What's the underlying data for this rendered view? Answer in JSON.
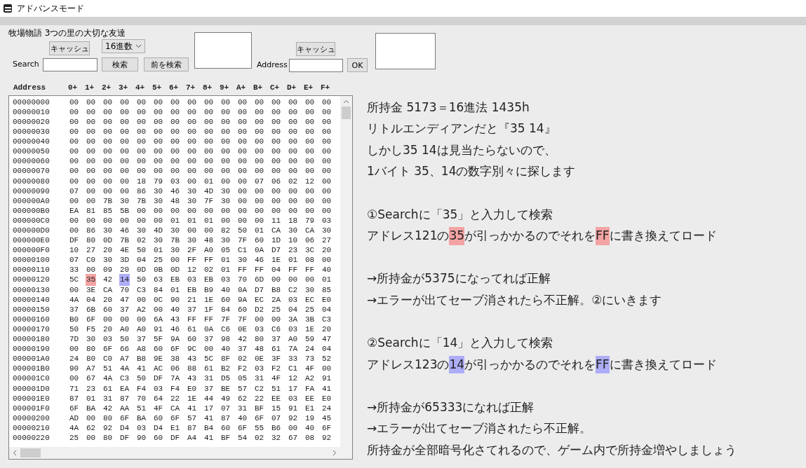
{
  "window": {
    "title": "アドバンスモード"
  },
  "game_title": "牧場物語 3つの里の大切な友達",
  "search_panel": {
    "cache_button": "キャッシュ",
    "radix_select": "16進数",
    "search_label": "Search",
    "search_button": "検索",
    "prev_button": "前を検索"
  },
  "address_panel": {
    "cache_button": "キャッシュ",
    "address_label": "Address",
    "ok_button": "OK"
  },
  "hex_header": {
    "address": "Address",
    "columns": [
      "0+",
      "1+",
      "2+",
      "3+",
      "4+",
      "5+",
      "6+",
      "7+",
      "8+",
      "9+",
      "A+",
      "B+",
      "C+",
      "D+",
      "E+",
      "F+"
    ]
  },
  "hex_rows": [
    {
      "address": "00000000",
      "bytes": [
        "00",
        "00",
        "00",
        "00",
        "00",
        "00",
        "00",
        "00",
        "00",
        "00",
        "00",
        "00",
        "00",
        "00",
        "00",
        "00"
      ]
    },
    {
      "address": "00000010",
      "bytes": [
        "00",
        "00",
        "00",
        "00",
        "00",
        "00",
        "00",
        "00",
        "00",
        "00",
        "00",
        "00",
        "00",
        "00",
        "00",
        "00"
      ]
    },
    {
      "address": "00000020",
      "bytes": [
        "00",
        "00",
        "00",
        "00",
        "00",
        "00",
        "00",
        "00",
        "00",
        "00",
        "00",
        "00",
        "00",
        "00",
        "00",
        "00"
      ]
    },
    {
      "address": "00000030",
      "bytes": [
        "00",
        "00",
        "00",
        "00",
        "00",
        "00",
        "00",
        "00",
        "00",
        "00",
        "00",
        "00",
        "00",
        "00",
        "00",
        "00"
      ]
    },
    {
      "address": "00000040",
      "bytes": [
        "00",
        "00",
        "00",
        "00",
        "00",
        "00",
        "00",
        "00",
        "00",
        "00",
        "00",
        "00",
        "00",
        "00",
        "00",
        "00"
      ]
    },
    {
      "address": "00000050",
      "bytes": [
        "00",
        "00",
        "00",
        "00",
        "00",
        "00",
        "00",
        "00",
        "00",
        "00",
        "00",
        "00",
        "00",
        "00",
        "00",
        "00"
      ]
    },
    {
      "address": "00000060",
      "bytes": [
        "00",
        "00",
        "00",
        "00",
        "00",
        "00",
        "00",
        "00",
        "00",
        "00",
        "00",
        "00",
        "00",
        "00",
        "00",
        "00"
      ]
    },
    {
      "address": "00000070",
      "bytes": [
        "00",
        "00",
        "00",
        "00",
        "00",
        "00",
        "00",
        "00",
        "00",
        "00",
        "00",
        "00",
        "00",
        "00",
        "00",
        "00"
      ]
    },
    {
      "address": "00000080",
      "bytes": [
        "00",
        "00",
        "00",
        "00",
        "18",
        "79",
        "03",
        "00",
        "01",
        "00",
        "00",
        "07",
        "06",
        "02",
        "12",
        "00"
      ]
    },
    {
      "address": "00000090",
      "bytes": [
        "07",
        "00",
        "00",
        "00",
        "86",
        "30",
        "46",
        "30",
        "4D",
        "30",
        "00",
        "00",
        "00",
        "00",
        "00",
        "00"
      ]
    },
    {
      "address": "000000A0",
      "bytes": [
        "00",
        "00",
        "7B",
        "30",
        "7B",
        "30",
        "48",
        "30",
        "7F",
        "30",
        "00",
        "00",
        "00",
        "00",
        "00",
        "00"
      ]
    },
    {
      "address": "000000B0",
      "bytes": [
        "EA",
        "81",
        "85",
        "5B",
        "00",
        "00",
        "00",
        "00",
        "00",
        "00",
        "00",
        "00",
        "00",
        "00",
        "00",
        "00"
      ]
    },
    {
      "address": "000000C0",
      "bytes": [
        "00",
        "00",
        "00",
        "00",
        "00",
        "00",
        "01",
        "01",
        "01",
        "00",
        "00",
        "00",
        "11",
        "18",
        "79",
        "03"
      ]
    },
    {
      "address": "000000D0",
      "bytes": [
        "00",
        "86",
        "30",
        "46",
        "30",
        "4D",
        "30",
        "00",
        "00",
        "82",
        "50",
        "01",
        "CA",
        "30",
        "CA",
        "30"
      ]
    },
    {
      "address": "000000E0",
      "bytes": [
        "DF",
        "80",
        "0D",
        "7B",
        "02",
        "30",
        "7B",
        "30",
        "48",
        "30",
        "7F",
        "60",
        "1D",
        "10",
        "06",
        "27"
      ]
    },
    {
      "address": "000000F0",
      "bytes": [
        "10",
        "27",
        "20",
        "4E",
        "50",
        "01",
        "30",
        "2F",
        "A0",
        "05",
        "C1",
        "0A",
        "D7",
        "23",
        "3C",
        "20"
      ]
    },
    {
      "address": "00000100",
      "bytes": [
        "07",
        "C0",
        "30",
        "3D",
        "04",
        "25",
        "00",
        "FF",
        "FF",
        "01",
        "30",
        "46",
        "1E",
        "01",
        "08",
        "00"
      ]
    },
    {
      "address": "00000110",
      "bytes": [
        "33",
        "00",
        "09",
        "20",
        "0D",
        "0B",
        "0D",
        "12",
        "02",
        "01",
        "FF",
        "FF",
        "04",
        "FF",
        "FF",
        "40"
      ]
    },
    {
      "address": "00000120",
      "bytes": [
        "5C",
        {
          "text": "35",
          "color": "#f4a3a3"
        },
        "42",
        {
          "text": "14",
          "color": "#adadf7"
        },
        "50",
        "63",
        "EB",
        "03",
        "EB",
        "03",
        "70",
        "6D",
        "00",
        "00",
        "00",
        "01"
      ]
    },
    {
      "address": "00000130",
      "bytes": [
        "00",
        "3E",
        "CA",
        "70",
        "C3",
        "84",
        "01",
        "EB",
        "B9",
        "40",
        "0A",
        "D7",
        "B8",
        "C2",
        "30",
        "85"
      ]
    },
    {
      "address": "00000140",
      "bytes": [
        "4A",
        "04",
        "20",
        "47",
        "00",
        "0C",
        "90",
        "21",
        "1E",
        "60",
        "9A",
        "EC",
        "2A",
        "03",
        "EC",
        "E0"
      ]
    },
    {
      "address": "00000150",
      "bytes": [
        "37",
        "6B",
        "60",
        "37",
        "A2",
        "00",
        "40",
        "37",
        "1F",
        "84",
        "60",
        "D2",
        "25",
        "04",
        "25",
        "04"
      ]
    },
    {
      "address": "00000160",
      "bytes": [
        "B0",
        "6F",
        "00",
        "00",
        "00",
        "6A",
        "43",
        "FF",
        "FF",
        "7F",
        "7F",
        "00",
        "00",
        "3A",
        "3B",
        "C3"
      ]
    },
    {
      "address": "00000170",
      "bytes": [
        "50",
        "F5",
        "20",
        "A0",
        "A0",
        "91",
        "46",
        "61",
        "0A",
        "C6",
        "0E",
        "03",
        "C6",
        "03",
        "1E",
        "20"
      ]
    },
    {
      "address": "00000180",
      "bytes": [
        "7D",
        "30",
        "03",
        "50",
        "37",
        "5F",
        "9A",
        "60",
        "37",
        "98",
        "42",
        "80",
        "37",
        "A0",
        "59",
        "47"
      ]
    },
    {
      "address": "00000190",
      "bytes": [
        "00",
        "80",
        "6F",
        "66",
        "A8",
        "60",
        "6F",
        "9C",
        "00",
        "40",
        "37",
        "48",
        "61",
        "7A",
        "24",
        "04"
      ]
    },
    {
      "address": "000001A0",
      "bytes": [
        "24",
        "80",
        "C0",
        "A7",
        "B8",
        "9E",
        "38",
        "43",
        "5C",
        "8F",
        "02",
        "0E",
        "3F",
        "33",
        "73",
        "52"
      ]
    },
    {
      "address": "000001B0",
      "bytes": [
        "90",
        "A7",
        "51",
        "4A",
        "41",
        "AC",
        "06",
        "88",
        "61",
        "B2",
        "F2",
        "03",
        "F2",
        "C1",
        "4F",
        "00"
      ]
    },
    {
      "address": "000001C0",
      "bytes": [
        "00",
        "67",
        "4A",
        "C3",
        "50",
        "DF",
        "7A",
        "43",
        "31",
        "D5",
        "05",
        "31",
        "4F",
        "12",
        "A2",
        "91"
      ]
    },
    {
      "address": "000001D0",
      "bytes": [
        "71",
        "23",
        "61",
        "EA",
        "F4",
        "03",
        "F4",
        "E0",
        "37",
        "BE",
        "57",
        "C2",
        "51",
        "17",
        "FA",
        "41"
      ]
    },
    {
      "address": "000001E0",
      "bytes": [
        "87",
        "01",
        "31",
        "87",
        "70",
        "64",
        "22",
        "1E",
        "44",
        "49",
        "62",
        "22",
        "EE",
        "03",
        "EE",
        "E0"
      ]
    },
    {
      "address": "000001F0",
      "bytes": [
        "6F",
        "BA",
        "42",
        "AA",
        "51",
        "4F",
        "CA",
        "41",
        "17",
        "07",
        "31",
        "BF",
        "15",
        "91",
        "E1",
        "24"
      ]
    },
    {
      "address": "00000200",
      "bytes": [
        "AD",
        "00",
        "80",
        "6F",
        "BA",
        "60",
        "6F",
        "57",
        "41",
        "87",
        "40",
        "6F",
        "07",
        "92",
        "19",
        "45"
      ]
    },
    {
      "address": "00000210",
      "bytes": [
        "4A",
        "62",
        "92",
        "D4",
        "03",
        "D4",
        "E1",
        "87",
        "B4",
        "60",
        "6F",
        "55",
        "B6",
        "00",
        "40",
        "6F"
      ]
    },
    {
      "address": "00000220",
      "bytes": [
        "25",
        "00",
        "80",
        "DF",
        "90",
        "60",
        "DF",
        "A4",
        "41",
        "BF",
        "54",
        "02",
        "32",
        "67",
        "08",
        "92"
      ]
    }
  ],
  "notes": [
    {
      "kind": "line",
      "segments": [
        {
          "text": "所持金 5173＝16進法 1435h"
        }
      ]
    },
    {
      "kind": "line",
      "segments": [
        {
          "text": "リトルエンディアンだと『35 14』"
        }
      ]
    },
    {
      "kind": "line",
      "segments": [
        {
          "text": "しかし35 14は見当たらないので、"
        }
      ]
    },
    {
      "kind": "line",
      "segments": [
        {
          "text": "1バイト 35、14の数字別々に探します"
        }
      ]
    },
    {
      "kind": "blank"
    },
    {
      "kind": "line",
      "segments": [
        {
          "text": "①Searchに「35」と入力して検索"
        }
      ]
    },
    {
      "kind": "line",
      "segments": [
        {
          "text": "アドレス121の"
        },
        {
          "text": "35",
          "color": "#f4a3a3"
        },
        {
          "text": "が引っかかるのでそれを"
        },
        {
          "text": "FF",
          "color": "#f4a3a3"
        },
        {
          "text": "に書き換えてロード"
        }
      ]
    },
    {
      "kind": "blank"
    },
    {
      "kind": "line",
      "segments": [
        {
          "text": "→所持金が5375になってれば正解"
        }
      ]
    },
    {
      "kind": "line",
      "segments": [
        {
          "text": "→エラーが出てセーブ消されたら不正解。②にいきます"
        }
      ]
    },
    {
      "kind": "blank"
    },
    {
      "kind": "line",
      "segments": [
        {
          "text": "②Searchに「14」と入力して検索"
        }
      ]
    },
    {
      "kind": "line",
      "segments": [
        {
          "text": "アドレス123の"
        },
        {
          "text": "14",
          "color": "#adadf7"
        },
        {
          "text": "が引っかかるのでそれを"
        },
        {
          "text": "FF",
          "color": "#adadf7"
        },
        {
          "text": "に書き換えてロード"
        }
      ]
    },
    {
      "kind": "blank"
    },
    {
      "kind": "line",
      "segments": [
        {
          "text": "→所持金が65333になれば正解"
        }
      ]
    },
    {
      "kind": "line",
      "segments": [
        {
          "text": "→エラーが出てセーブ消されたら不正解。"
        }
      ]
    },
    {
      "kind": "line",
      "segments": [
        {
          "text": "所持金が全部暗号化さてれるので、ゲーム内で所持金増やしましょう"
        }
      ]
    }
  ]
}
